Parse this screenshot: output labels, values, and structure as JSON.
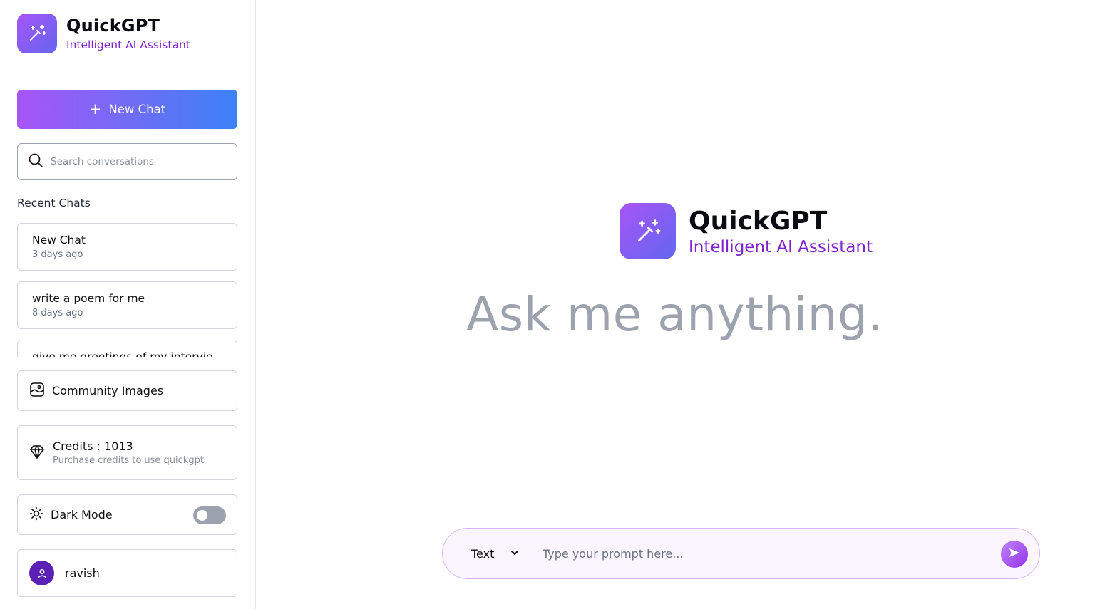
{
  "brand": {
    "name": "QuickGPT",
    "tagline": "Intelligent AI Assistant"
  },
  "sidebar": {
    "new_chat_label": "New Chat",
    "search_placeholder": "Search conversations",
    "recent_title": "Recent Chats",
    "recent_chats": [
      {
        "title": "New Chat",
        "time": "3 days ago"
      },
      {
        "title": "write a poem for me",
        "time": "8 days ago"
      },
      {
        "title": "give me greetings of my intervie",
        "time": ""
      }
    ],
    "community_label": "Community Images",
    "credits": {
      "title": "Credits : 1013",
      "subtitle": "Purchase credits to use quickgpt"
    },
    "dark_mode_label": "Dark Mode",
    "dark_mode_on": false,
    "user_name": "ravish"
  },
  "main": {
    "heading": "Ask me anything.",
    "mode_selected": "Text",
    "prompt_placeholder": "Type your prompt here..."
  },
  "colors": {
    "accent_purple": "#a855f7",
    "accent_blue": "#3b82f6",
    "tagline_purple": "#7e22ce",
    "heading_gray": "#9ca3af"
  }
}
